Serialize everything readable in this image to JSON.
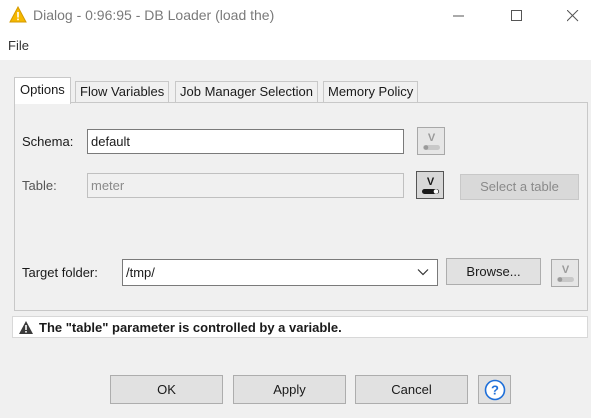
{
  "window": {
    "title": "Dialog - 0:96:95 - DB Loader (load the)",
    "title_icon": "warning-triangle-icon",
    "controls": [
      "minimize-icon",
      "maximize-icon",
      "close-icon"
    ]
  },
  "menu": {
    "file": "File"
  },
  "tabs": [
    {
      "label": "Options",
      "active": true
    },
    {
      "label": "Flow Variables",
      "active": false
    },
    {
      "label": "Job Manager Selection",
      "active": false
    },
    {
      "label": "Memory Policy",
      "active": false
    }
  ],
  "form": {
    "schema_label": "Schema:",
    "schema_value": "default",
    "table_label": "Table:",
    "table_value": "meter",
    "select_table_button": "Select a table",
    "target_folder_label": "Target folder:",
    "target_folder_value": "/tmp/",
    "browse_button": "Browse..."
  },
  "status": {
    "icon": "warning-icon",
    "message": "The \"table\" parameter is controlled by a variable."
  },
  "buttons": {
    "ok": "OK",
    "apply": "Apply",
    "cancel": "Cancel",
    "help_icon": "help-icon"
  },
  "colors": {
    "warning_title": "#f5b800",
    "help_blue": "#1e6fd9"
  }
}
